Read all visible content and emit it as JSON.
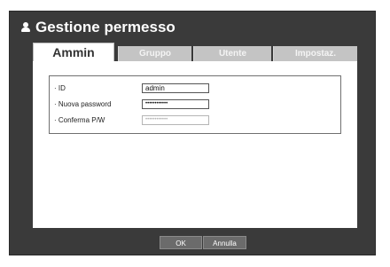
{
  "window": {
    "title": "Gestione permesso"
  },
  "tabs": [
    {
      "label": "Ammin"
    },
    {
      "label": "Gruppo"
    },
    {
      "label": "Utente"
    },
    {
      "label": "Impostaz."
    }
  ],
  "form": {
    "id": {
      "label": "· ID",
      "value": "admin"
    },
    "new_password": {
      "label": "· Nuova password",
      "value": "••••••••••••"
    },
    "confirm_password": {
      "label": "· Conferma P/W",
      "value": "••••••••••••"
    }
  },
  "buttons": {
    "ok": "OK",
    "cancel": "Annulla"
  },
  "icons": {
    "title": "user-icon"
  },
  "colors": {
    "dialog_bg": "#3a3a3a",
    "tab_inactive": "#c4c4c4",
    "button_bg": "#6b6b6b"
  }
}
